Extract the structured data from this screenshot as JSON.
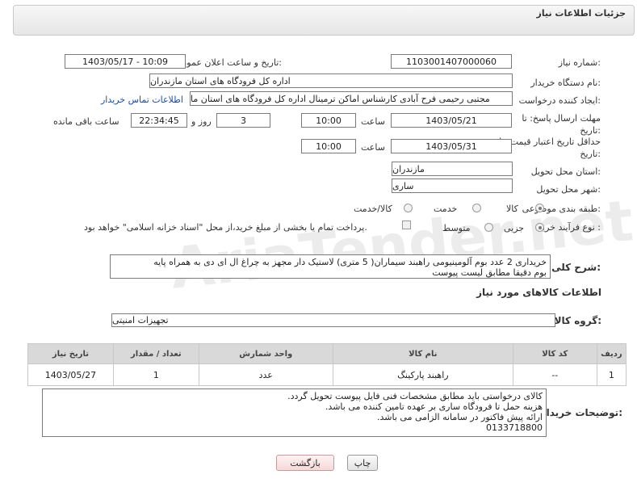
{
  "header": {
    "title": "جزئیات اطلاعات نیاز"
  },
  "fields": {
    "need_number_label": "شماره نیاز:",
    "need_number": "1103001407000060",
    "announce_label": "تاریخ و ساعت اعلان عمومی:",
    "announce_value": "1403/05/17 - 10:09",
    "buyer_org_label": "نام دستگاه خریدار:",
    "buyer_org": "اداره کل فرودگاه های استان مازندران",
    "creator_label": "ایجاد کننده درخواست:",
    "creator": "مجتبی رحیمی فرح آبادی کارشناس اماکن ترمینال اداره کل فرودگاه های استان ما",
    "contact_link": "اطلاعات تماس خریدار",
    "deadline_label": "مهلت ارسال پاسخ: تا تاریخ:",
    "deadline_date": "1403/05/21",
    "time_label": "ساعت",
    "deadline_time": "10:00",
    "days_count": "3",
    "days_label": "روز و",
    "remaining_time": "22:34:45",
    "remaining_label": "ساعت باقی مانده",
    "min_validity_label": "حداقل تاریخ اعتبار قیمت: تا تاریخ:",
    "validity_date": "1403/05/31",
    "validity_time": "10:00",
    "province_label": "استان محل تحویل:",
    "province": "مازندران",
    "city_label": "شهر محل تحویل:",
    "city": "ساری",
    "category_label": "طبقه بندی موضوعی:",
    "category_options": [
      "کالا",
      "خدمت",
      "کالا/خدمت"
    ],
    "process_label": "نوع فرآیند خرید :",
    "process_options": [
      "جزیی",
      "متوسط"
    ],
    "payment_note": "پرداخت تمام یا بخشی از مبلغ خرید،از محل \"اسناد خزانه اسلامی\" خواهد بود.",
    "desc_label": "شرح کلی نیاز:",
    "description_line1": "خریداری 2 عدد بوم آلومینیومی راهبند سیماران( 5  متری) لاستیک دار مجهز به چراغ ال ای دی به همراه پایه",
    "description_line2": "بوم دقیقا مطابق لیست پیوست",
    "goods_info_title": "اطلاعات کالاهای مورد نیاز",
    "goods_group_label": "گروه کالا:",
    "goods_group": "تجهیزات امنیتی"
  },
  "table": {
    "headers": [
      "ردیف",
      "کد کالا",
      "نام کالا",
      "واحد شمارش",
      "تعداد / مقدار",
      "تاریخ نیاز"
    ],
    "rows": [
      [
        "1",
        "--",
        "راهبند پارکینگ",
        "عدد",
        "1",
        "1403/05/27"
      ]
    ]
  },
  "notes": {
    "label": "توضیحات خریدار:",
    "lines": [
      "کالای درخواستی باید مطابق مشخصات فنی فایل پیوست تحویل گردد.",
      "هزینه حمل تا فرودگاه ساری بر عهده تامین کننده می باشد.",
      "ارائه پیش فاکتور در سامانه الزامی می باشد.",
      "0133718800"
    ]
  },
  "buttons": {
    "print": "چاپ",
    "back": "بازگشت"
  },
  "watermark": "AriaTender.net"
}
